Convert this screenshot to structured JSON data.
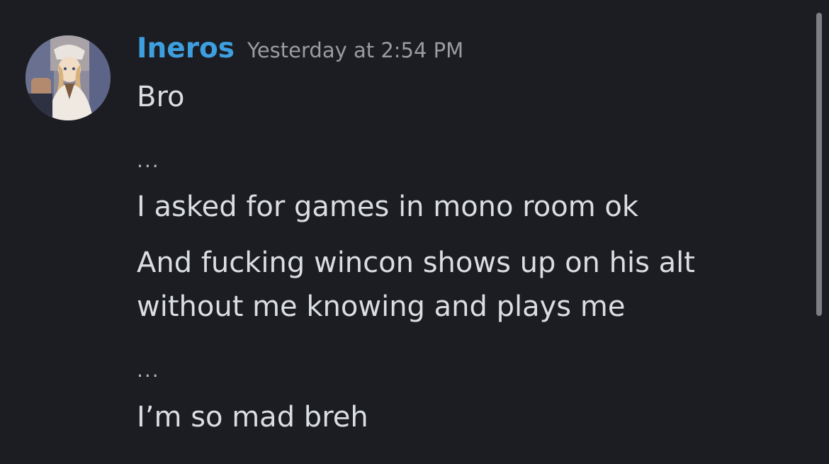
{
  "message": {
    "author": "Ineros",
    "timestamp": "Yesterday at 2:54 PM",
    "lines": [
      "Bro",
      "...",
      "I asked for games in mono room ok",
      "And fucking wincon shows up on his alt",
      "without me knowing and plays me",
      "...",
      "I’m so mad breh"
    ]
  },
  "colors": {
    "background": "#1c1d22",
    "username": "#3d9fe0",
    "text": "#dbdee1",
    "timestamp": "#9a9ca2"
  },
  "icons": {
    "avatar": "anime-character-avatar"
  }
}
